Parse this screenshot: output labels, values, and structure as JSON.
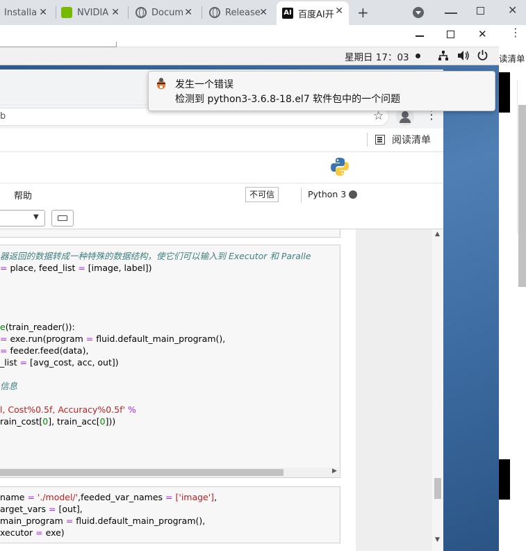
{
  "outer_tabs": [
    {
      "title": "Installa",
      "icon": "blank-page-icon"
    },
    {
      "title": "NVIDIA",
      "icon": "nvidia-icon"
    },
    {
      "title": "Docum",
      "icon": "globe-icon"
    },
    {
      "title": "Release",
      "icon": "globe-icon"
    },
    {
      "title": "百度AI开",
      "icon": "ai-logo-icon",
      "active": true
    }
  ],
  "outer_right": {
    "bookmarks_fragment": "读清单"
  },
  "gnome": {
    "datetime": "星期日 17：03"
  },
  "notification": {
    "title": "发生一个错误",
    "body": "检测到  python3-3.6.8-18.el7 软件包中的一个问题"
  },
  "inner_browser": {
    "address_fragment": "b",
    "reading_list_label": "阅读清单"
  },
  "jupyter": {
    "menu_help": "帮助",
    "trust_label": "不可信",
    "kernel_label": "Python 3"
  },
  "cell1": {
    "lines": [
      [
        {
          "t": "器返回的数据转成一种特殊的数据结构，使它们可以输入到 Executor 和 Paralle",
          "c": "cm"
        }
      ],
      [
        {
          "t": "= ",
          "c": "op"
        },
        {
          "t": "place, feed_list ",
          "c": ""
        },
        {
          "t": "= ",
          "c": "op"
        },
        {
          "t": "[image, label])",
          "c": ""
        }
      ],
      [],
      [],
      [],
      [],
      [
        {
          "t": "e",
          "c": "kw"
        },
        {
          "t": "(train_reader()):",
          "c": ""
        }
      ],
      [
        {
          "t": "= ",
          "c": "op"
        },
        {
          "t": "exe.run(program ",
          "c": ""
        },
        {
          "t": "= ",
          "c": "op"
        },
        {
          "t": "fluid.default_main_program(),",
          "c": ""
        }
      ],
      [
        {
          "t": "= ",
          "c": "op"
        },
        {
          "t": "feeder.feed(data),",
          "c": ""
        }
      ],
      [
        {
          "t": "_list ",
          "c": ""
        },
        {
          "t": "= ",
          "c": "op"
        },
        {
          "t": "[avg_cost, acc, out])",
          "c": ""
        }
      ],
      [],
      [
        {
          "t": "信息",
          "c": "cm"
        }
      ],
      [],
      [
        {
          "t": "l, Cost",
          "c": "str"
        },
        {
          "t": "%",
          "c": "str"
        },
        {
          "t": "0.5f, Accuracy",
          "c": "str"
        },
        {
          "t": "%",
          "c": "str"
        },
        {
          "t": "0.5f' ",
          "c": "str"
        },
        {
          "t": "%",
          "c": "op"
        }
      ],
      [
        {
          "t": "rain_cost[",
          "c": ""
        },
        {
          "t": "0",
          "c": "num"
        },
        {
          "t": "], train_acc[",
          "c": ""
        },
        {
          "t": "0",
          "c": "num"
        },
        {
          "t": "]))",
          "c": ""
        }
      ]
    ]
  },
  "cell2": {
    "lines": [
      [
        {
          "t": "name ",
          "c": ""
        },
        {
          "t": "= ",
          "c": "op"
        },
        {
          "t": "'./model/'",
          "c": "str"
        },
        {
          "t": ",feeded_var_names ",
          "c": ""
        },
        {
          "t": "= ",
          "c": "op"
        },
        {
          "t": "['image']",
          "c": "str"
        },
        {
          "t": ",",
          "c": ""
        }
      ],
      [
        {
          "t": "arget_vars ",
          "c": ""
        },
        {
          "t": "= ",
          "c": "op"
        },
        {
          "t": "[out],",
          "c": ""
        }
      ],
      [
        {
          "t": "main_program ",
          "c": ""
        },
        {
          "t": "= ",
          "c": "op"
        },
        {
          "t": "fluid.default_main_program(),",
          "c": ""
        }
      ],
      [
        {
          "t": "xecutor ",
          "c": ""
        },
        {
          "t": "= ",
          "c": "op"
        },
        {
          "t": "exe)",
          "c": ""
        }
      ]
    ]
  },
  "colors": {
    "desktop": "#3b6aa0",
    "code_comment": "#408080",
    "code_keyword": "#008000",
    "code_operator": "#aa22ff",
    "code_string": "#ba2121"
  }
}
